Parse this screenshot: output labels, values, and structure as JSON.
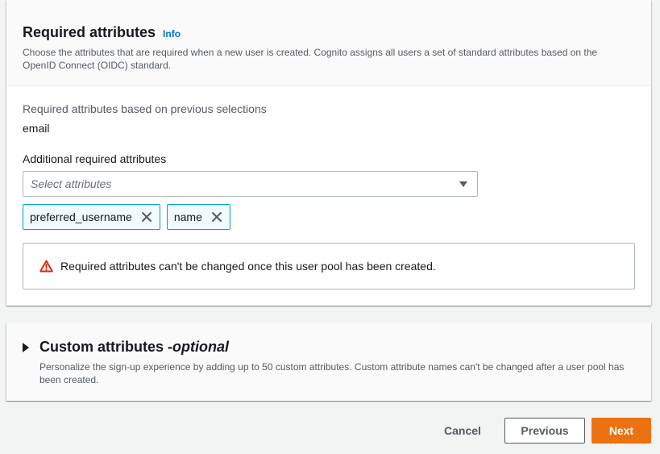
{
  "required_attributes": {
    "title": "Required attributes",
    "info_label": "Info",
    "description": "Choose the attributes that are required when a new user is created. Cognito assigns all users a set of standard attributes based on the OpenID Connect (OIDC) standard.",
    "previous_selections_label": "Required attributes based on previous selections",
    "previous_selections_value": "email",
    "additional_label": "Additional required attributes",
    "select_placeholder": "Select attributes",
    "tokens": [
      {
        "label": "preferred_username"
      },
      {
        "label": "name"
      }
    ],
    "alert_text": "Required attributes can't be changed once this user pool has been created."
  },
  "custom_attributes": {
    "title": "Custom attributes - ",
    "title_optional": "optional",
    "description": "Personalize the sign-up experience by adding up to 50 custom attributes. Custom attribute names can't be changed after a user pool has been created."
  },
  "footer": {
    "cancel_label": "Cancel",
    "previous_label": "Previous",
    "next_label": "Next"
  },
  "colors": {
    "link": "#0073bb",
    "primary_button": "#ec7211",
    "token_border": "#00a1c9",
    "warning_icon": "#d13212"
  }
}
